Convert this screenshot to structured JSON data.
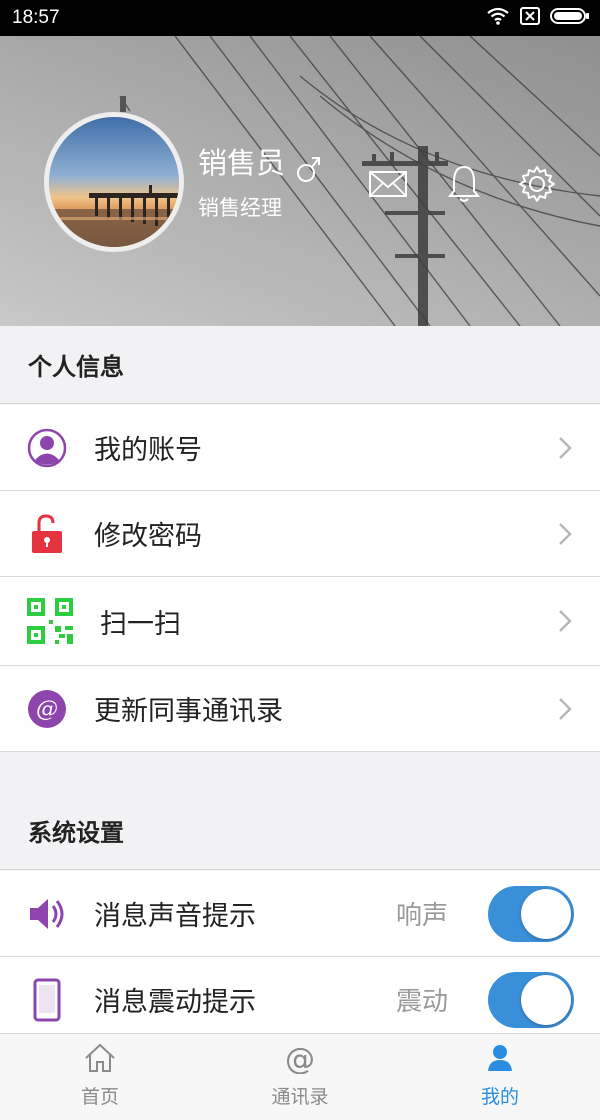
{
  "status_bar": {
    "time": "18:57"
  },
  "profile": {
    "name": "销售员",
    "role": "销售经理",
    "gender_icon": "male-symbol-icon"
  },
  "header_actions": [
    {
      "name": "mail-icon"
    },
    {
      "name": "bell-icon"
    },
    {
      "name": "gear-icon"
    }
  ],
  "sections": {
    "personal": {
      "title": "个人信息",
      "items": [
        {
          "label": "我的账号",
          "icon": "user-icon",
          "color": "#8e44ad"
        },
        {
          "label": "修改密码",
          "icon": "unlock-icon",
          "color": "#e5333f"
        },
        {
          "label": "扫一扫",
          "icon": "qr-code-icon",
          "color": "#2ecc40"
        },
        {
          "label": "更新同事通讯录",
          "icon": "at-icon",
          "color": "#8e44ad"
        }
      ]
    },
    "system": {
      "title": "系统设置",
      "items": [
        {
          "label": "消息声音提示",
          "value": "响声",
          "icon": "speaker-icon",
          "color": "#8e44ad",
          "toggle_on": true
        },
        {
          "label": "消息震动提示",
          "value": "震动",
          "icon": "phone-icon",
          "color": "#8e44ad",
          "toggle_on": true
        }
      ]
    }
  },
  "bottom_nav": [
    {
      "label": "首页",
      "icon": "home-icon"
    },
    {
      "label": "通讯录",
      "icon": "at-icon"
    },
    {
      "label": "我的",
      "icon": "person-icon",
      "active": true
    }
  ],
  "colors": {
    "accent": "#2b8de0",
    "toggle": "#3a8fd9",
    "purple": "#8e44ad",
    "red": "#e5333f",
    "green": "#2ecc40"
  }
}
